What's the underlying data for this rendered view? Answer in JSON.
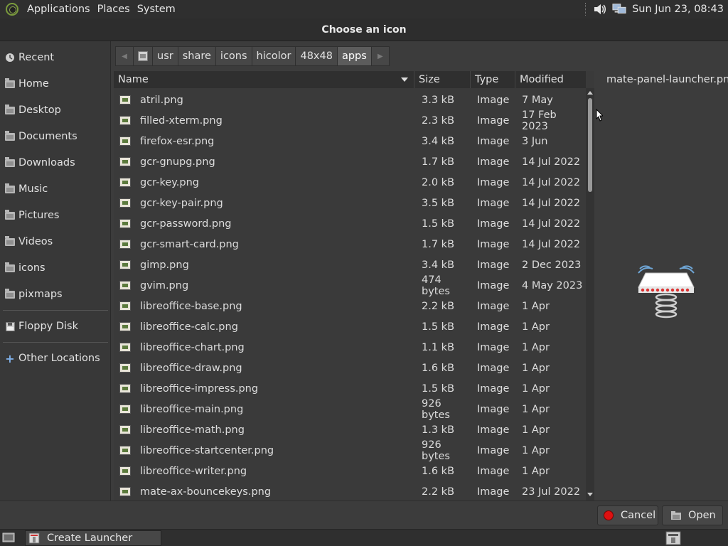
{
  "topbar": {
    "menus": [
      "Applications",
      "Places",
      "System"
    ],
    "clock": "Sun Jun 23, 08:43"
  },
  "dialog": {
    "title": "Choose an icon"
  },
  "sidebar": {
    "items": [
      {
        "label": "Recent",
        "icon": "recent-icon"
      },
      {
        "label": "Home",
        "icon": "home-icon"
      },
      {
        "label": "Desktop",
        "icon": "desktop-folder-icon"
      },
      {
        "label": "Documents",
        "icon": "folder-icon"
      },
      {
        "label": "Downloads",
        "icon": "folder-icon"
      },
      {
        "label": "Music",
        "icon": "folder-icon"
      },
      {
        "label": "Pictures",
        "icon": "folder-icon"
      },
      {
        "label": "Videos",
        "icon": "folder-icon"
      },
      {
        "label": "icons",
        "icon": "folder-icon"
      },
      {
        "label": "pixmaps",
        "icon": "folder-icon"
      }
    ],
    "devices": [
      {
        "label": "Floppy Disk",
        "icon": "floppy-icon"
      }
    ],
    "other": {
      "label": "Other Locations",
      "icon": "plus-icon"
    }
  },
  "pathbar": {
    "crumbs": [
      "usr",
      "share",
      "icons",
      "hicolor",
      "48x48",
      "apps"
    ],
    "active": "apps"
  },
  "filelist": {
    "columns": {
      "name": "Name",
      "size": "Size",
      "type": "Type",
      "modified": "Modified"
    },
    "rows": [
      {
        "name": "atril.png",
        "size": "3.3 kB",
        "type": "Image",
        "modified": "7 May"
      },
      {
        "name": "filled-xterm.png",
        "size": "2.3 kB",
        "type": "Image",
        "modified": "17 Feb 2023"
      },
      {
        "name": "firefox-esr.png",
        "size": "3.4 kB",
        "type": "Image",
        "modified": "3 Jun"
      },
      {
        "name": "gcr-gnupg.png",
        "size": "1.7 kB",
        "type": "Image",
        "modified": "14 Jul 2022"
      },
      {
        "name": "gcr-key.png",
        "size": "2.0 kB",
        "type": "Image",
        "modified": "14 Jul 2022"
      },
      {
        "name": "gcr-key-pair.png",
        "size": "3.5 kB",
        "type": "Image",
        "modified": "14 Jul 2022"
      },
      {
        "name": "gcr-password.png",
        "size": "1.5 kB",
        "type": "Image",
        "modified": "14 Jul 2022"
      },
      {
        "name": "gcr-smart-card.png",
        "size": "1.7 kB",
        "type": "Image",
        "modified": "14 Jul 2022"
      },
      {
        "name": "gimp.png",
        "size": "3.4 kB",
        "type": "Image",
        "modified": "2 Dec 2023"
      },
      {
        "name": "gvim.png",
        "size": "474 bytes",
        "type": "Image",
        "modified": "4 May 2023"
      },
      {
        "name": "libreoffice-base.png",
        "size": "2.2 kB",
        "type": "Image",
        "modified": "1 Apr"
      },
      {
        "name": "libreoffice-calc.png",
        "size": "1.5 kB",
        "type": "Image",
        "modified": "1 Apr"
      },
      {
        "name": "libreoffice-chart.png",
        "size": "1.1 kB",
        "type": "Image",
        "modified": "1 Apr"
      },
      {
        "name": "libreoffice-draw.png",
        "size": "1.6 kB",
        "type": "Image",
        "modified": "1 Apr"
      },
      {
        "name": "libreoffice-impress.png",
        "size": "1.5 kB",
        "type": "Image",
        "modified": "1 Apr"
      },
      {
        "name": "libreoffice-main.png",
        "size": "926 bytes",
        "type": "Image",
        "modified": "1 Apr"
      },
      {
        "name": "libreoffice-math.png",
        "size": "1.3 kB",
        "type": "Image",
        "modified": "1 Apr"
      },
      {
        "name": "libreoffice-startcenter.png",
        "size": "926 bytes",
        "type": "Image",
        "modified": "1 Apr"
      },
      {
        "name": "libreoffice-writer.png",
        "size": "1.6 kB",
        "type": "Image",
        "modified": "1 Apr"
      },
      {
        "name": "mate-ax-bouncekeys.png",
        "size": "2.2 kB",
        "type": "Image",
        "modified": "23 Jul 2022"
      }
    ]
  },
  "preview": {
    "filename": "mate-panel-launcher.png",
    "icon": "panel-launcher-icon"
  },
  "buttons": {
    "cancel": "Cancel",
    "open": "Open"
  },
  "taskbar": {
    "task_label": "Create Launcher"
  }
}
